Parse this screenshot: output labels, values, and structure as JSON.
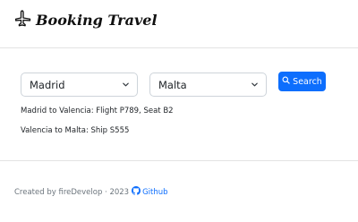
{
  "header": {
    "brand": "Booking Travel",
    "logo_icon": "airplane-icon"
  },
  "search": {
    "origin_value": "Madrid",
    "destination_value": "Malta",
    "button_label": "Search"
  },
  "results": [
    {
      "text": "Madrid to Valencia: Flight P789, Seat B2"
    },
    {
      "text": "Valencia to Malta: Ship S555"
    }
  ],
  "footer": {
    "credit": "Created by fireDevelop · 2023",
    "github_label": "Github"
  },
  "colors": {
    "accent": "#0d6efd",
    "muted": "#6c757d"
  }
}
